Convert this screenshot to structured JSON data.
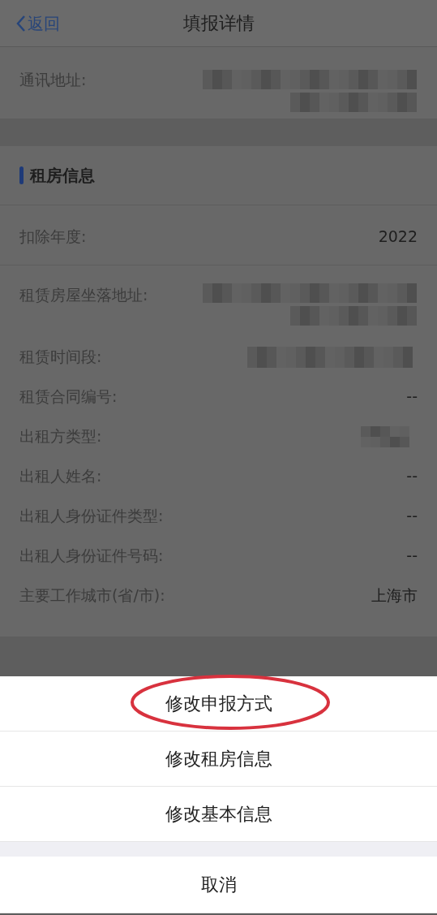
{
  "nav": {
    "back": "返回",
    "title": "填报详情"
  },
  "top_rows": [
    {
      "label": "通讯地址:",
      "kind": "blurblock"
    }
  ],
  "sections": [
    {
      "title": "租房信息",
      "groups": [
        [
          {
            "label": "扣除年度:",
            "kind": "text",
            "value": "2022"
          }
        ],
        [
          {
            "label": "租赁房屋坐落地址:",
            "kind": "blurblock"
          },
          {
            "label": "租赁时间段:",
            "kind": "blurline"
          },
          {
            "label": "租赁合同编号:",
            "kind": "text",
            "value": "--"
          },
          {
            "label": "出租方类型:",
            "kind": "blurchip"
          },
          {
            "label": "出租人姓名:",
            "kind": "text",
            "value": "--"
          },
          {
            "label": "出租人身份证件类型:",
            "kind": "text",
            "value": "--"
          },
          {
            "label": "出租人身份证件号码:",
            "kind": "text",
            "value": "--"
          },
          {
            "label": "主要工作城市(省/市):",
            "kind": "text",
            "value": "上海市"
          }
        ]
      ]
    }
  ],
  "action_sheet": {
    "items": [
      {
        "label": "修改申报方式",
        "circled": true
      },
      {
        "label": "修改租房信息",
        "circled": false
      },
      {
        "label": "修改基本信息",
        "circled": false
      }
    ],
    "cancel": "取消"
  }
}
